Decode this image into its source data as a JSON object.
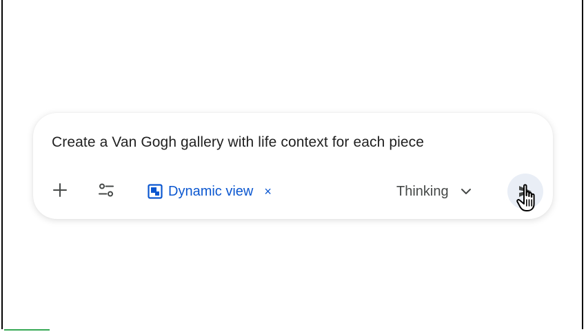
{
  "prompt": {
    "text": "Create a Van Gogh gallery with life context for each piece"
  },
  "toolbar": {
    "add_icon": "plus-icon",
    "tools_icon": "tune-settings-icon",
    "chip": {
      "icon": "dynamic-view-icon",
      "label": "Dynamic view",
      "close_symbol": "×"
    },
    "mode": {
      "label": "Thinking",
      "icon": "chevron-down-icon"
    },
    "send_icon": "send-icon"
  },
  "colors": {
    "accent_blue": "#0b57d0",
    "text_primary": "#1f1f1f",
    "text_secondary": "#444746",
    "send_bg": "#e9eef6",
    "bottom_accent": "#34a853"
  }
}
